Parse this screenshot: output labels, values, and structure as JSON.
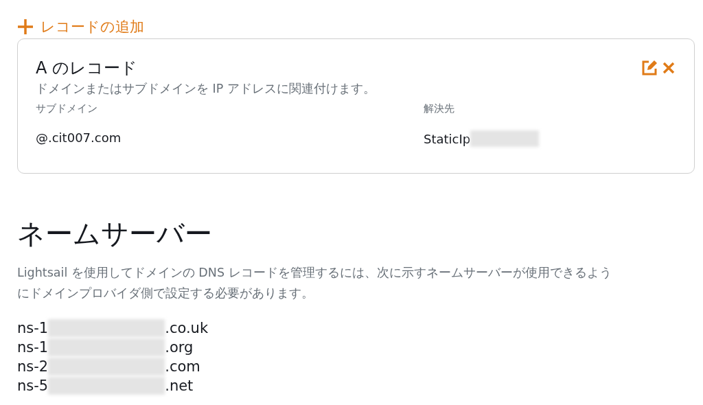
{
  "add_record": {
    "label": "レコードの追加"
  },
  "record": {
    "title": "A のレコード",
    "description": "ドメインまたはサブドメインを IP アドレスに関連付けます。",
    "fields": [
      {
        "label": "サブドメイン",
        "value": "@.cit007.com",
        "redacted": false
      },
      {
        "label": "解決先",
        "value": "StaticIp",
        "redacted": true
      }
    ]
  },
  "nameservers": {
    "heading": "ネームサーバー",
    "description": "Lightsail を使用してドメインの DNS レコードを管理するには、次に示すネームサーバーが使用できるようにドメインプロバイダ側で設定する必要があります。",
    "items": [
      {
        "prefix": "ns-1",
        "suffix": ".co.uk",
        "redacted": true
      },
      {
        "prefix": "ns-1",
        "suffix": ".org",
        "redacted": true
      },
      {
        "prefix": "ns-2",
        "suffix": ".com",
        "redacted": true
      },
      {
        "prefix": "ns-5",
        "suffix": ".net",
        "redacted": true
      }
    ]
  }
}
